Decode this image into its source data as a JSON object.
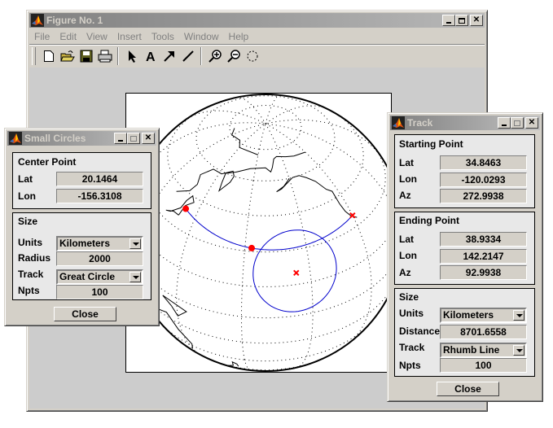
{
  "figure": {
    "title": "Figure No. 1",
    "menu": [
      "File",
      "Edit",
      "View",
      "Insert",
      "Tools",
      "Window",
      "Help"
    ],
    "toolbar": [
      "new-file-icon",
      "open-folder-icon",
      "save-icon",
      "print-icon",
      "select-arrow-icon",
      "text-icon",
      "arrow-icon",
      "line-icon",
      "zoom-in-icon",
      "zoom-out-icon",
      "rotate-icon"
    ]
  },
  "globe": {
    "track_color": "#0000cc",
    "marker_color": "#ff0000",
    "points": {
      "start": {
        "lat": 34.8463,
        "lon": -120.0293,
        "marker": "x"
      },
      "end": {
        "lat": 38.9334,
        "lon": 142.2147,
        "marker": "dot"
      },
      "mid": {
        "marker": "dot"
      },
      "circle_center": {
        "lat": 20.1464,
        "lon": -156.3108,
        "marker": "x"
      }
    },
    "circle_radius_km": 2000
  },
  "small_circles": {
    "title": "Small Circles",
    "center_point": {
      "title": "Center Point",
      "lat_label": "Lat",
      "lat": "20.1464",
      "lon_label": "Lon",
      "lon": "-156.3108"
    },
    "size": {
      "title": "Size",
      "units_label": "Units",
      "units": "Kilometers",
      "radius_label": "Radius",
      "radius": "2000",
      "track_label": "Track",
      "track": "Great Circle",
      "npts_label": "Npts",
      "npts": "100"
    },
    "close_label": "Close"
  },
  "track": {
    "title": "Track",
    "starting_point": {
      "title": "Starting Point",
      "lat_label": "Lat",
      "lat": "34.8463",
      "lon_label": "Lon",
      "lon": "-120.0293",
      "az_label": "Az",
      "az": "272.9938"
    },
    "ending_point": {
      "title": "Ending Point",
      "lat_label": "Lat",
      "lat": "38.9334",
      "lon_label": "Lon",
      "lon": "142.2147",
      "az_label": "Az",
      "az": "92.9938"
    },
    "size": {
      "title": "Size",
      "units_label": "Units",
      "units": "Kilometers",
      "distance_label": "Distance",
      "distance": "8701.6558",
      "track_label": "Track",
      "track": "Rhumb Line",
      "npts_label": "Npts",
      "npts": "100"
    },
    "close_label": "Close"
  }
}
